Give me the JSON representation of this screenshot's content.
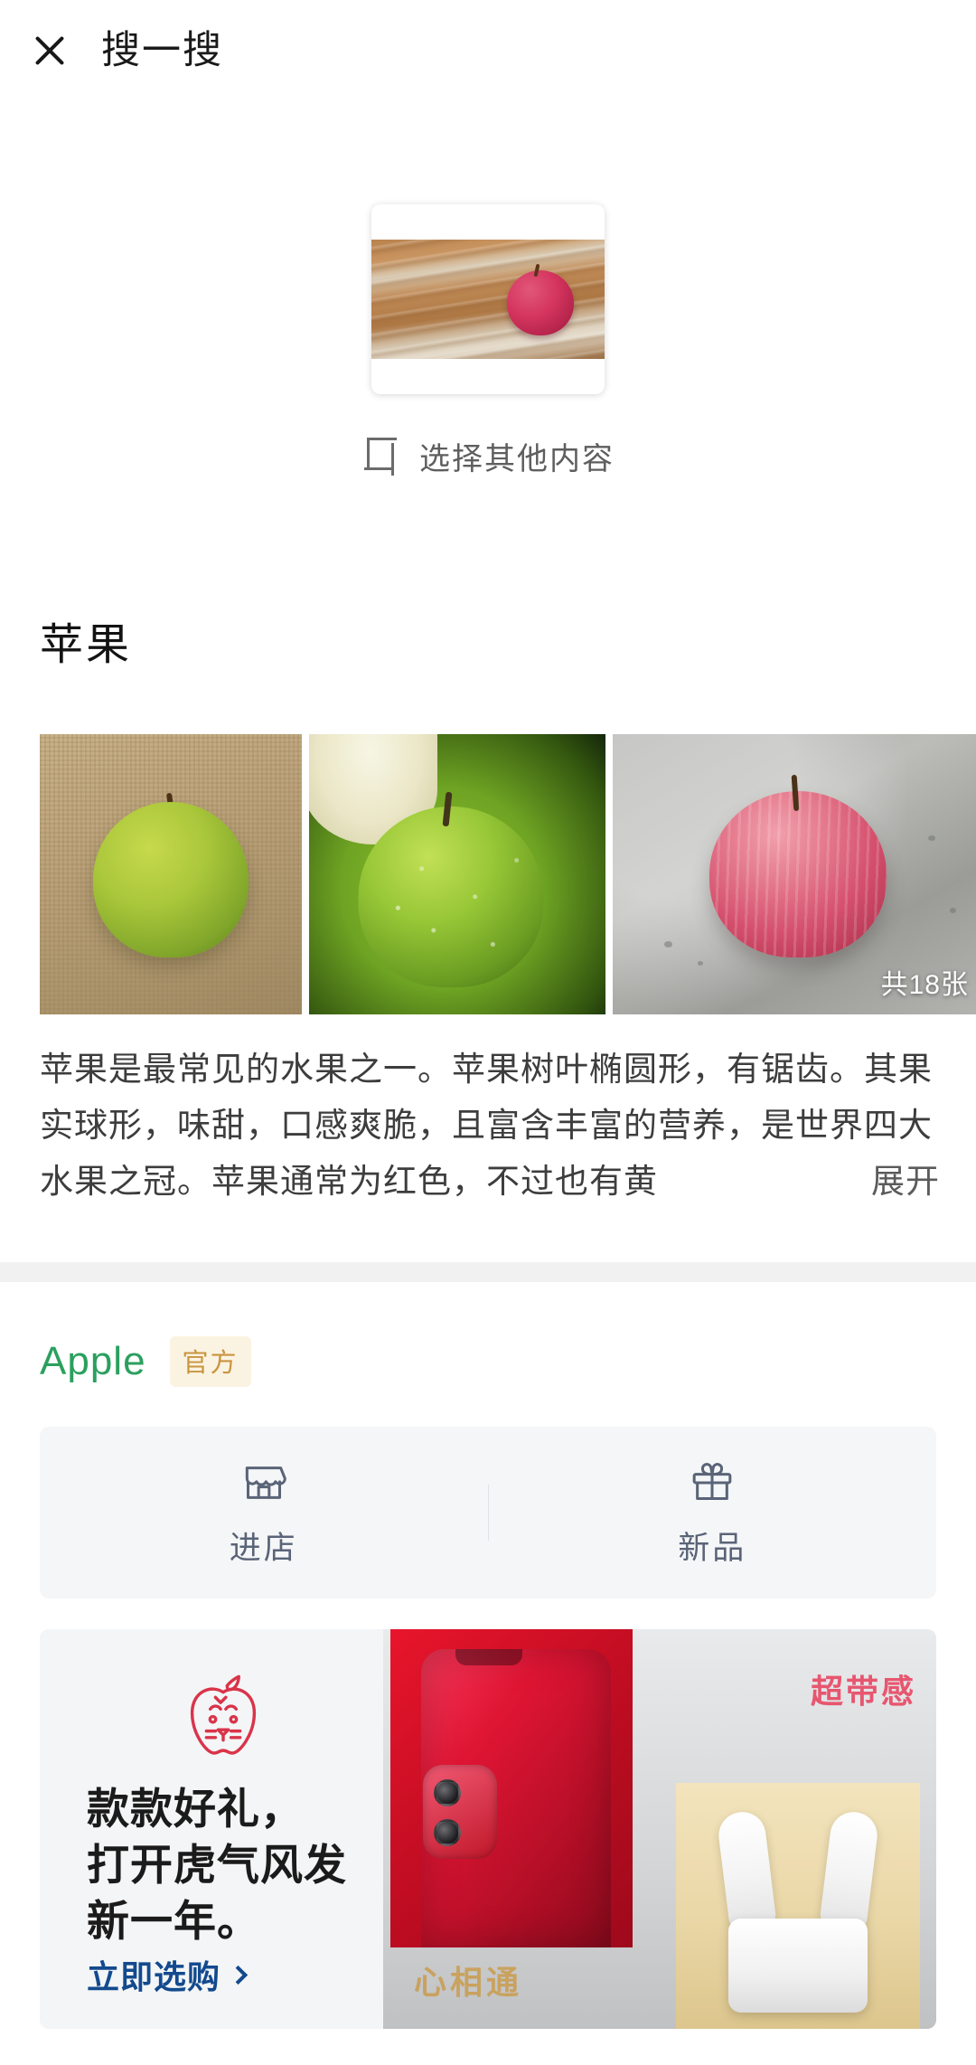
{
  "header": {
    "close_icon": "close-icon",
    "title": "搜一搜"
  },
  "capture": {
    "thumbnail_alt": "红苹果放在木桌上的照片",
    "pick_icon": "crop-frame-icon",
    "pick_label": "选择其他内容"
  },
  "entity": {
    "title": "苹果",
    "gallery": [
      {
        "alt": "麻布上的青苹果"
      },
      {
        "alt": "带水珠的青苹果特写"
      },
      {
        "alt": "水泥台面上的红苹果"
      }
    ],
    "gallery_count": "共18张",
    "description": "苹果是最常见的水果之一。苹果树叶椭圆形，有锯齿。其果实球形，味甜，口感爽脆，且富含丰富的营养，是世界四大水果之冠。苹果通常为红色，不过也有黄",
    "expand_label": "展开"
  },
  "brand": {
    "name": "Apple",
    "badge": "官方",
    "name_color": "#2ba05e",
    "badge_color": "#c9953f",
    "badge_bg": "#fbf3e2",
    "actions": [
      {
        "icon": "storefront-icon",
        "label": "进店"
      },
      {
        "icon": "gift-icon",
        "label": "新品"
      }
    ]
  },
  "promo": {
    "logo_icon": "tiger-apple-logo-icon",
    "headline_line1": "款款好礼，",
    "headline_line2": "打开虎气风发",
    "headline_line3": "新一年。",
    "cta_label": "立即选购",
    "cta_chevron": "chevron-right-icon",
    "tag_top": "超带感",
    "tag_bottom": "心相通",
    "cta_color": "#134a8e",
    "tag_top_color": "#e7566f",
    "tag_bottom_color": "#c9a25f"
  }
}
